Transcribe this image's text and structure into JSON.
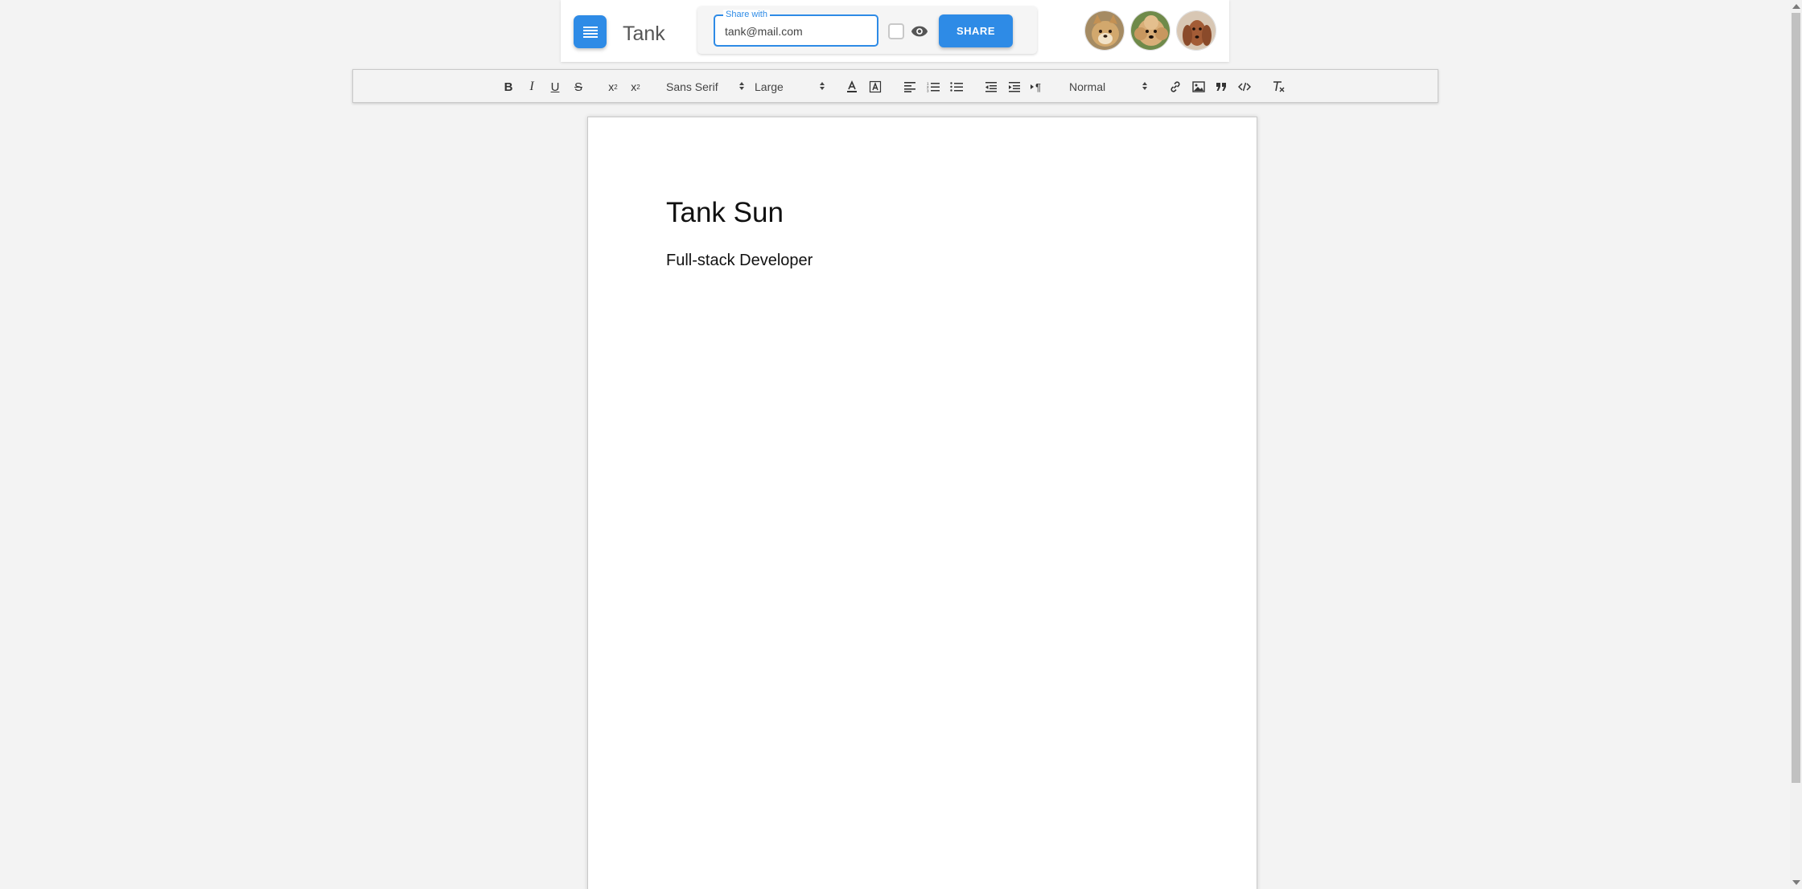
{
  "header": {
    "app_title": "Tank",
    "share": {
      "label": "Share with",
      "value": "tank@mail.com",
      "button_label": "SHARE"
    },
    "avatars": [
      {
        "name": "avatar-shiba-dog",
        "color": "#c8a26a"
      },
      {
        "name": "avatar-poodle-dog",
        "color": "#d8b07a"
      },
      {
        "name": "avatar-spaniel-dog",
        "color": "#9c5a35"
      }
    ]
  },
  "toolbar": {
    "font_family": "Sans Serif",
    "font_size": "Large",
    "heading": "Normal"
  },
  "document": {
    "heading": "Tank Sun",
    "subtitle": "Full-stack Developer"
  },
  "colors": {
    "accent": "#2e8be6",
    "background": "#f3f3f3"
  }
}
